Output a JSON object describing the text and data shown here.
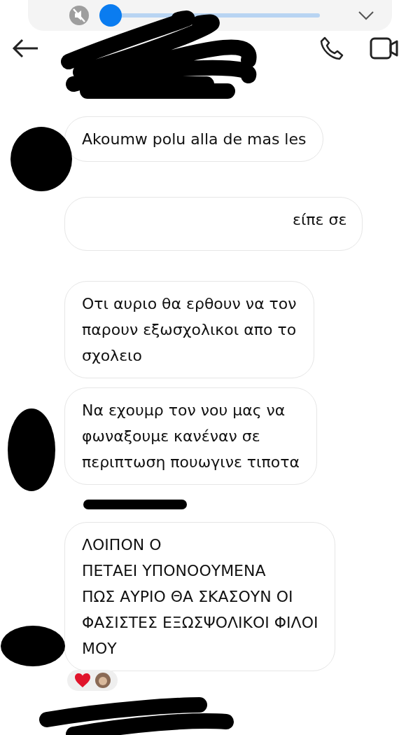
{
  "media_bar": {
    "muted": true,
    "level": 0
  },
  "messages": [
    {
      "kind": "text",
      "lines": [
        "Akoumw polu alla de mas les"
      ]
    },
    {
      "kind": "erased",
      "lines": [
        "είπε σε"
      ]
    },
    {
      "kind": "text",
      "lines": [
        "Οτι αυριο θα ερθουν να τον",
        "παρουν εξωσχολικοι απο το",
        "σχολειο"
      ]
    },
    {
      "kind": "text",
      "lines": [
        "Να εχουμρ τον νου μας να",
        "φωναξουμε κανέναν σε",
        "περιπτωση πουωγινε τιποτα"
      ]
    },
    {
      "kind": "text",
      "lines": [
        "ΛΟΙΠΟΝ Ο",
        "ΠΕΤΑΕΙ ΥΠΟΝΟΟΥΜΕΝΑ",
        "ΠΩΣ ΑΥΡΙΟ ΘΑ ΣΚΑΣΟΥΝ ΟΙ",
        "ΦΑΣΙΣΤΕΣ ΕΞΩΣΨΟΛΙΚΟΙ ΦΙΛΟΙ",
        "ΜΟΥ"
      ]
    }
  ],
  "reactions": {
    "heart": true,
    "reactor_avatar": true
  }
}
